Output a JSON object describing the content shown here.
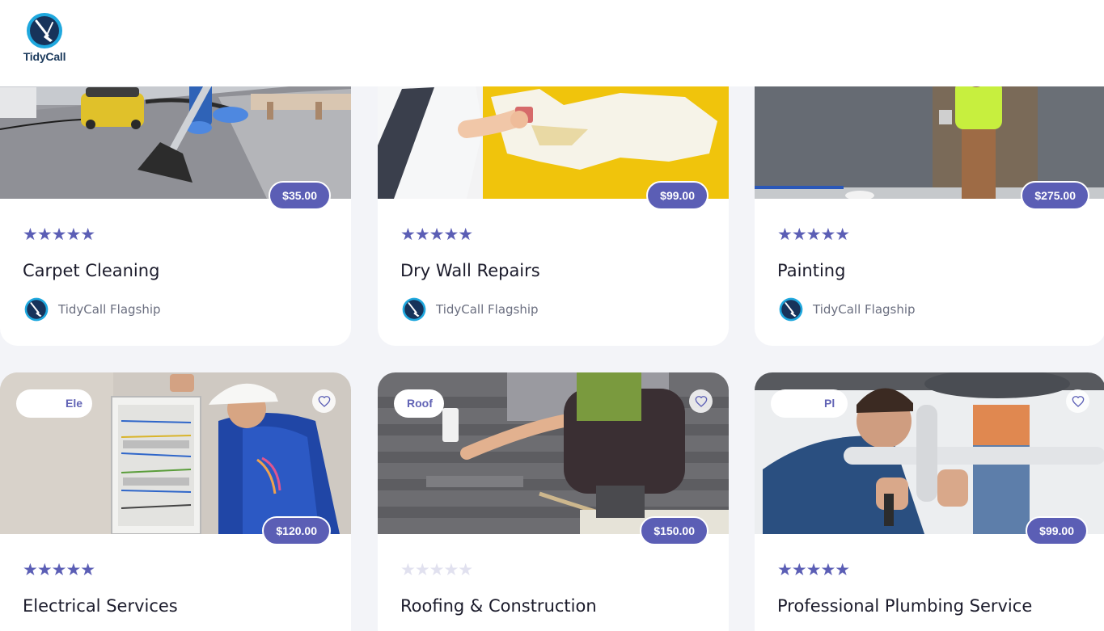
{
  "brand": {
    "name": "TidyCall"
  },
  "colors": {
    "accent": "#5b5eb5",
    "star_empty": "#e1e1ef",
    "page_bg": "#f3f4f8"
  },
  "services": [
    {
      "title": "Carpet Cleaning",
      "price": "$35.00",
      "rating": 5,
      "stars": "★★★★★",
      "provider": "TidyCall Flagship"
    },
    {
      "title": "Dry Wall Repairs",
      "price": "$99.00",
      "rating": 5,
      "stars": "★★★★★",
      "provider": "TidyCall Flagship"
    },
    {
      "title": "Painting",
      "price": "$275.00",
      "rating": 5,
      "stars": "★★★★★",
      "provider": "TidyCall Flagship"
    },
    {
      "title": "Electrical Services",
      "price": "$120.00",
      "rating": 5,
      "stars": "★★★★★",
      "category": "Ele",
      "favorite_icon": "heart-icon"
    },
    {
      "title": "Roofing & Construction",
      "price": "$150.00",
      "rating": 0,
      "stars": "★★★★★",
      "category": "Roof",
      "favorite_icon": "heart-icon"
    },
    {
      "title": "Professional Plumbing Service",
      "price": "$99.00",
      "rating": 5,
      "stars": "★★★★★",
      "category": "Pl",
      "favorite_icon": "heart-icon"
    }
  ]
}
